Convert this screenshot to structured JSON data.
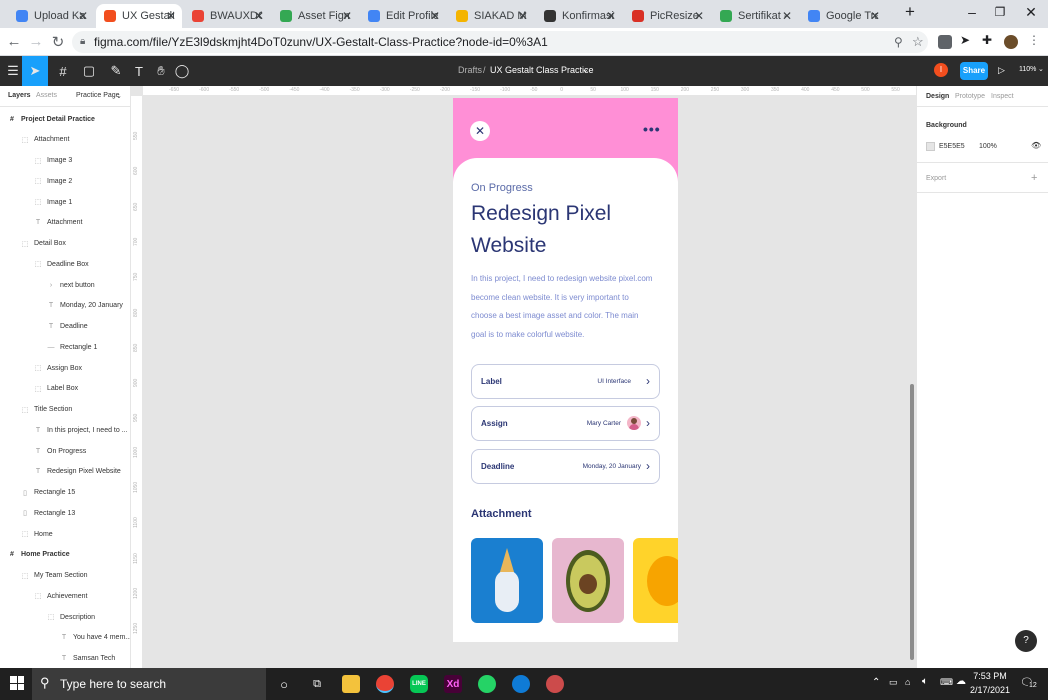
{
  "browser": {
    "tabs": [
      {
        "title": "Upload Kary",
        "icon": "globe-icon",
        "color": "#4285f4",
        "active": false
      },
      {
        "title": "UX Gestalt C",
        "icon": "figma-icon",
        "color": "#f24e1e",
        "active": true
      },
      {
        "title": "BWAUXDG",
        "icon": "gmail-icon",
        "color": "#ea4335",
        "active": false
      },
      {
        "title": "Asset Figma",
        "icon": "drive-icon",
        "color": "#34a853",
        "active": false
      },
      {
        "title": "Edit Profile",
        "icon": "globe-icon",
        "color": "#4285f4",
        "active": false
      },
      {
        "title": "SIAKAD MH",
        "icon": "siakad-icon",
        "color": "#f4b400",
        "active": false
      },
      {
        "title": "Konfirmasi P",
        "icon": "github-icon",
        "color": "#333333",
        "active": false
      },
      {
        "title": "PicResize -",
        "icon": "picresize-icon",
        "color": "#d93025",
        "active": false
      },
      {
        "title": "Sertifikat -",
        "icon": "drive-icon",
        "color": "#34a853",
        "active": false
      },
      {
        "title": "Google Tran",
        "icon": "translate-icon",
        "color": "#4285f4",
        "active": false
      }
    ],
    "new_tab": "+",
    "window": {
      "minimize": "–",
      "restore": "❐",
      "close": "✕"
    },
    "url": "figma.com/file/YzE3l9dskmjht4DoT0zunv/UX-Gestalt-Class-Practice?node-id=0%3A1"
  },
  "figma": {
    "breadcrumb_drafts": "Drafts",
    "breadcrumb_sep": "/",
    "file_name": "UX Gestalt Class Practice",
    "avatar_initial": "I",
    "share": "Share",
    "zoom": "110%",
    "left_tabs": {
      "layers": "Layers",
      "assets": "Assets",
      "page": "Practice Page"
    },
    "layers": [
      {
        "name": "Project Detail Practice",
        "icon": "frame",
        "depth": 0
      },
      {
        "name": "Attachment",
        "icon": "group",
        "depth": 1
      },
      {
        "name": "Image 3",
        "icon": "group",
        "depth": 2
      },
      {
        "name": "Image 2",
        "icon": "group",
        "depth": 2
      },
      {
        "name": "Image 1",
        "icon": "group",
        "depth": 2
      },
      {
        "name": "Attachment",
        "icon": "text",
        "depth": 2
      },
      {
        "name": "Detail Box",
        "icon": "group",
        "depth": 1
      },
      {
        "name": "Deadline Box",
        "icon": "group",
        "depth": 2
      },
      {
        "name": "next button",
        "icon": "chevron",
        "depth": 3
      },
      {
        "name": "Monday, 20 January",
        "icon": "text",
        "depth": 3
      },
      {
        "name": "Deadline",
        "icon": "text",
        "depth": 3
      },
      {
        "name": "Rectangle 1",
        "icon": "line",
        "depth": 3
      },
      {
        "name": "Assign Box",
        "icon": "group",
        "depth": 2
      },
      {
        "name": "Label Box",
        "icon": "group",
        "depth": 2
      },
      {
        "name": "Title Section",
        "icon": "group",
        "depth": 1
      },
      {
        "name": "In this project, I need to ...",
        "icon": "text",
        "depth": 2
      },
      {
        "name": "On Progress",
        "icon": "text",
        "depth": 2
      },
      {
        "name": "Redesign Pixel Website",
        "icon": "text",
        "depth": 2
      },
      {
        "name": "Rectangle 15",
        "icon": "rect",
        "depth": 1
      },
      {
        "name": "Rectangle 13",
        "icon": "rect",
        "depth": 1
      },
      {
        "name": "Home",
        "icon": "group",
        "depth": 1
      },
      {
        "name": "Home Practice",
        "icon": "frame",
        "depth": 0
      },
      {
        "name": "My Team Section",
        "icon": "group",
        "depth": 1
      },
      {
        "name": "Achievement",
        "icon": "group",
        "depth": 2
      },
      {
        "name": "Description",
        "icon": "group",
        "depth": 3
      },
      {
        "name": "You have 4 mem...",
        "icon": "text",
        "depth": 4
      },
      {
        "name": "Samsan Tech",
        "icon": "text",
        "depth": 4
      }
    ],
    "ruler_x": [
      "-650",
      "-600",
      "-550",
      "-500",
      "-450",
      "-400",
      "-350",
      "-300",
      "-250",
      "-200",
      "-150",
      "-100",
      "-50",
      "0",
      "50",
      "100",
      "150",
      "200",
      "250",
      "300",
      "350",
      "400",
      "450",
      "500",
      "550"
    ],
    "ruler_y": [
      "550",
      "600",
      "650",
      "700",
      "750",
      "800",
      "850",
      "900",
      "950",
      "1000",
      "1050",
      "1100",
      "1150",
      "1200",
      "1250"
    ],
    "right_tabs": {
      "design": "Design",
      "prototype": "Prototype",
      "inspect": "Inspect"
    },
    "background_label": "Background",
    "background_hex": "E5E5E5",
    "background_opacity": "100%",
    "export_label": "Export",
    "export_add": "+"
  },
  "design": {
    "status": "On Progress",
    "title_line1": "Redesign Pixel",
    "title_line2": "Website",
    "description_lines": [
      "In this project, I need to redesign website pixel.com",
      "become clean website. It is very important to",
      "choose a best image asset and color. The main",
      "goal is to make colorful website."
    ],
    "rows": [
      {
        "label": "Label",
        "value": "UI Interface"
      },
      {
        "label": "Assign",
        "value": "Mary Carter"
      },
      {
        "label": "Deadline",
        "value": "Monday, 20 January"
      }
    ],
    "attachment_title": "Attachment",
    "colors": {
      "header_pink": "#ff8fd6",
      "navy": "#2b3674",
      "accent": "#5b6ba8",
      "text_light": "#7d8bd0"
    }
  },
  "taskbar": {
    "search_placeholder": "Type here to search",
    "time": "7:53 PM",
    "date": "2/17/2021",
    "notification_count": "12"
  }
}
